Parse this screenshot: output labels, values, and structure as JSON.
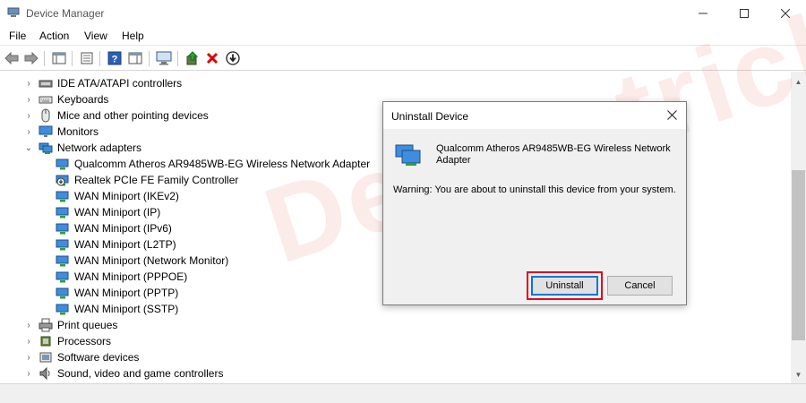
{
  "window": {
    "title": "Device Manager"
  },
  "menu": [
    "File",
    "Action",
    "View",
    "Help"
  ],
  "tree": {
    "categories": [
      {
        "label": "IDE ATA/ATAPI controllers",
        "icon": "ide-controller-icon",
        "expanded": false
      },
      {
        "label": "Keyboards",
        "icon": "keyboard-icon",
        "expanded": false
      },
      {
        "label": "Mice and other pointing devices",
        "icon": "mouse-icon",
        "expanded": false
      },
      {
        "label": "Monitors",
        "icon": "monitor-icon",
        "expanded": false
      },
      {
        "label": "Network adapters",
        "icon": "network-adapter-icon",
        "expanded": true
      }
    ],
    "network_children": [
      "Qualcomm Atheros AR9485WB-EG Wireless Network Adapter",
      "Realtek PCIe FE Family Controller",
      "WAN Miniport (IKEv2)",
      "WAN Miniport (IP)",
      "WAN Miniport (IPv6)",
      "WAN Miniport (L2TP)",
      "WAN Miniport (Network Monitor)",
      "WAN Miniport (PPPOE)",
      "WAN Miniport (PPTP)",
      "WAN Miniport (SSTP)"
    ],
    "categories_after": [
      {
        "label": "Print queues",
        "icon": "printer-icon"
      },
      {
        "label": "Processors",
        "icon": "processor-icon"
      },
      {
        "label": "Software devices",
        "icon": "software-device-icon"
      },
      {
        "label": "Sound, video and game controllers",
        "icon": "sound-icon"
      }
    ]
  },
  "dialog": {
    "title": "Uninstall Device",
    "device_name": "Qualcomm Atheros AR9485WB-EG Wireless Network Adapter",
    "warning": "Warning: You are about to uninstall this device from your system.",
    "uninstall_label": "Uninstall",
    "cancel_label": "Cancel"
  },
  "watermark": "Devicetricks",
  "colors": {
    "highlight": "#e5001c",
    "accent": "#0078d7",
    "delete": "#e00000"
  }
}
